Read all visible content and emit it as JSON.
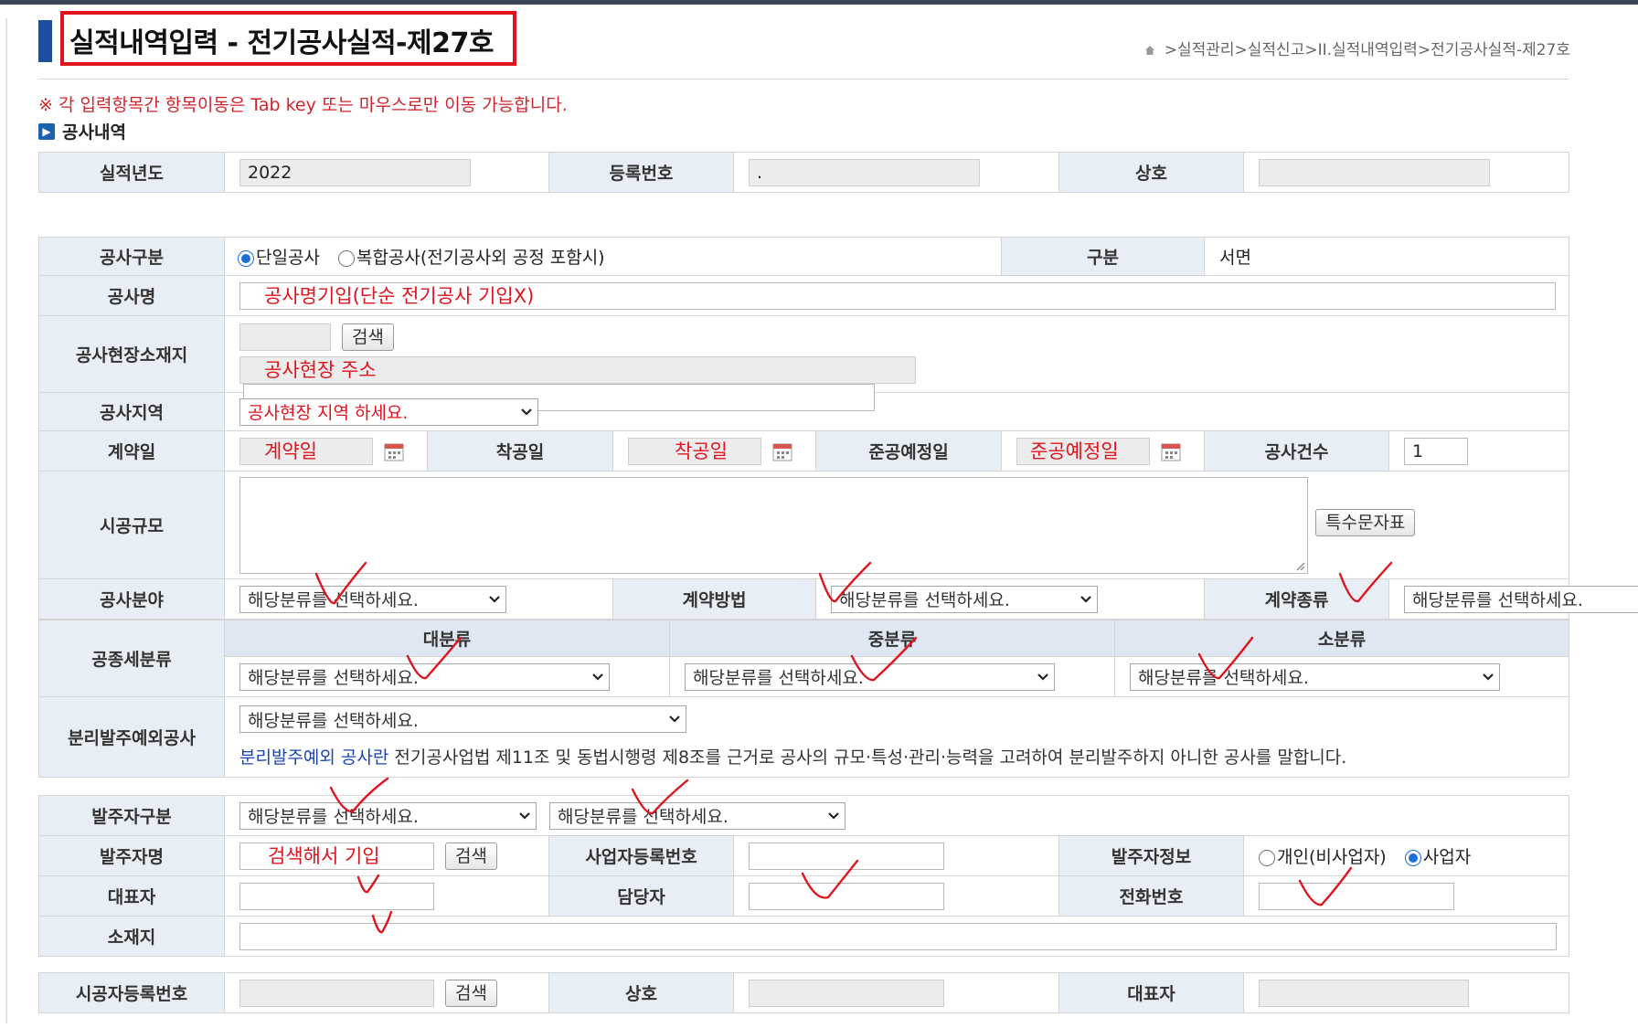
{
  "header": {
    "title": "실적내역입력 - 전기공사실적-제27호",
    "breadcrumb": ">실적관리>실적신고>II.실적내역입력>전기공사실적-제27호"
  },
  "notice": "※ 각 입력항목간 항목이동은 Tab key 또는 마우스로만 이동 가능합니다.",
  "section_title": "공사내역",
  "summary": {
    "year_label": "실적년도",
    "year_value": "2022",
    "reg_no_label": "등록번호",
    "reg_no_value": ".",
    "company_label": "상호"
  },
  "work": {
    "type_label": "공사구분",
    "radio_single": "단일공사",
    "radio_combined": "복합공사(전기공사외 공정 포함시)",
    "category_label": "구분",
    "category_value": "서면",
    "name_label": "공사명",
    "name_value": "공사명기입(단순 전기공사 기입X)",
    "site_label": "공사현장소재지",
    "search_button": "검색",
    "site_address": "공사현장 주소",
    "region_label": "공사지역",
    "region_select": "공사현장 지역 하세요.",
    "contract_date_label": "계약일",
    "contract_date_value": "계약일",
    "start_date_label": "착공일",
    "start_date_value": "착공일",
    "completion_label": "준공예정일",
    "completion_value": "준공예정일",
    "count_label": "공사건수",
    "count_value": "1",
    "scale_label": "시공규모",
    "special_char_button": "특수문자표",
    "field_label": "공사분야",
    "method_label": "계약방법",
    "contract_type_label": "계약종류",
    "select_placeholder": "해당분류를 선택하세요.",
    "subclass_label": "공종세분류",
    "major_label": "대분류",
    "middle_label": "중분류",
    "minor_label": "소분류",
    "exception_label": "분리발주예외공사",
    "exception_note_lead": "분리발주예외 공사란",
    "exception_note_body": " 전기공사업법 제11조 및 동법시행령 제8조를 근거로 공사의 규모·특성·관리·능력을 고려하여 분리발주하지 아니한 공사를 말합니다."
  },
  "client": {
    "type_label": "발주자구분",
    "name_label": "발주자명",
    "name_value": "검색해서 기입",
    "biz_no_label": "사업자등록번호",
    "info_label": "발주자정보",
    "radio_individual": "개인(비사업자)",
    "radio_business": "사업자",
    "rep_label": "대표자",
    "manager_label": "담당자",
    "phone_label": "전화번호",
    "address_label": "소재지"
  },
  "builder": {
    "reg_no_label": "시공자등록번호",
    "company_label": "상호",
    "rep_label": "대표자"
  },
  "colors": {
    "header_cell": "#e8eef5",
    "annotation_red": "#e0141e",
    "accent_blue": "#1d4f9c"
  }
}
